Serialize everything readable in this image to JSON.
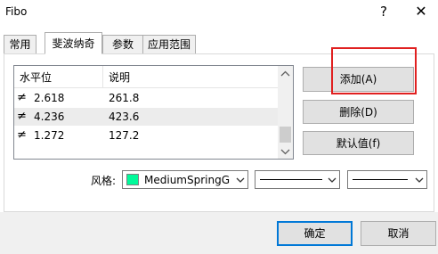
{
  "window": {
    "title": "Fibo",
    "help_label": "?",
    "close_label": "✕"
  },
  "tabs": [
    {
      "label": "常用"
    },
    {
      "label": "斐波纳奇"
    },
    {
      "label": "参数"
    },
    {
      "label": "应用范围"
    }
  ],
  "list": {
    "columns": [
      "水平位",
      "说明"
    ],
    "row_icon": "≠",
    "rows": [
      {
        "level": "2.618",
        "desc": "261.8"
      },
      {
        "level": "4.236",
        "desc": "423.6"
      },
      {
        "level": "1.272",
        "desc": "127.2"
      }
    ]
  },
  "buttons": {
    "add": "添加(A)",
    "delete": "删除(D)",
    "default": "默认值(f)"
  },
  "style": {
    "label": "风格:",
    "color_name": "MediumSpringG",
    "color_value": "#00fa9a"
  },
  "dialog": {
    "ok": "确定",
    "cancel": "取消"
  }
}
